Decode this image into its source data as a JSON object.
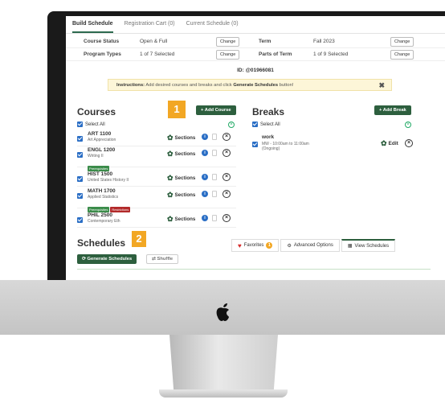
{
  "tabs": [
    {
      "label": "Build Schedule",
      "active": true
    },
    {
      "label": "Registration Cart (0)",
      "active": false
    },
    {
      "label": "Current Schedule (0)",
      "active": false
    }
  ],
  "status": {
    "course_status_label": "Course Status",
    "course_status_value": "Open & Full",
    "program_types_label": "Program Types",
    "program_types_value": "1 of 7 Selected",
    "term_label": "Term",
    "term_value": "Fall 2023",
    "parts_label": "Parts of Term",
    "parts_value": "1 of 9 Selected",
    "change_label": "Change"
  },
  "id_line": "ID: @01966081",
  "instructions": {
    "prefix": "Instructions:",
    "text": " Add desired courses and breaks and click ",
    "bold": "Generate Schedules",
    "suffix": " button!"
  },
  "courses": {
    "title": "Courses",
    "add_label": "+ Add Course",
    "select_all": "Select All",
    "items": [
      {
        "code": "ART 1100",
        "name": "Art Appreciation",
        "tags": []
      },
      {
        "code": "ENGL 1200",
        "name": "Writing II",
        "tags": [
          {
            "label": "Prerequisites",
            "color": "green"
          }
        ]
      },
      {
        "code": "HIST 1500",
        "name": "United States History II",
        "tags": []
      },
      {
        "code": "MATH 1700",
        "name": "Applied Statistics",
        "tags": [
          {
            "label": "Prerequisites",
            "color": "green"
          },
          {
            "label": "Restrictions",
            "color": "red"
          }
        ]
      },
      {
        "code": "PHIL 2500",
        "name": "Contemporary Eth",
        "tags": []
      }
    ],
    "sections_label": "Sections"
  },
  "breaks": {
    "title": "Breaks",
    "add_label": "+ Add Break",
    "select_all": "Select All",
    "item": {
      "name": "work",
      "time": "MW - 10:00am to 11:00am",
      "note": "(Ongoing)",
      "edit_label": "Edit"
    }
  },
  "schedules": {
    "title": "Schedules",
    "favorites_label": "Favorites",
    "favorites_count": "1",
    "advanced_label": "Advanced Options",
    "view_label": "View Schedules",
    "generate_label": "Generate Schedules",
    "shuffle_label": "Shuffle"
  },
  "callouts": {
    "one": "1",
    "two": "2"
  },
  "colors": {
    "accent": "#2d5f3e",
    "callout": "#f2a724",
    "info": "#2a6ec5"
  }
}
